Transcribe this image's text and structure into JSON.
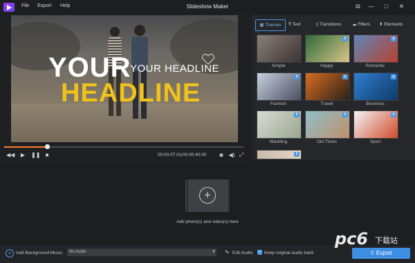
{
  "window": {
    "title": "Slideshow Maker",
    "menu": [
      "File",
      "Export",
      "Help"
    ],
    "controls": {
      "screenshot": "⧉",
      "minimize": "—",
      "maximize": "□",
      "close": "✕"
    }
  },
  "preview": {
    "headline_line1": "YOUR",
    "headline_small": "YOUR HEADLINE",
    "headline_line2": "HEADLINE",
    "headline_color": "#f0c21c"
  },
  "playback": {
    "progress_fraction": 0.18,
    "timecode": "00:00:07.01/00:00:40.00",
    "accent": "#ff7a2e"
  },
  "panel": {
    "tabs": [
      {
        "label": "Themes",
        "icon": "themes-icon",
        "selected": true
      },
      {
        "label": "Text",
        "icon": "text-icon"
      },
      {
        "label": "Transitions",
        "icon": "transitions-icon"
      },
      {
        "label": "Filters",
        "icon": "filters-icon"
      },
      {
        "label": "Elements",
        "icon": "elements-icon"
      }
    ],
    "themes": [
      {
        "label": "Simple",
        "colors": [
          "#8a7f78",
          "#3c3432"
        ],
        "download": false
      },
      {
        "label": "Happy",
        "colors": [
          "#2f6b3a",
          "#d8c489"
        ],
        "download": true
      },
      {
        "label": "Romantic",
        "colors": [
          "#5f86b8",
          "#b8412f"
        ],
        "download": true
      },
      {
        "label": "Fashion",
        "colors": [
          "#c7d1de",
          "#4b4f63"
        ],
        "download": true
      },
      {
        "label": "Travel",
        "colors": [
          "#d96d1f",
          "#2b2119"
        ],
        "download": true
      },
      {
        "label": "Business",
        "colors": [
          "#2f7fcf",
          "#0f3a68"
        ],
        "download": true
      },
      {
        "label": "Wedding",
        "colors": [
          "#d9dbd6",
          "#9aa68e"
        ],
        "download": true
      },
      {
        "label": "Old Times",
        "colors": [
          "#8fc0c9",
          "#c08f6a"
        ],
        "download": true
      },
      {
        "label": "Sport",
        "colors": [
          "#f2f4f7",
          "#d04b2a"
        ],
        "download": true
      }
    ]
  },
  "storyboard": {
    "add_text": "Add photo(s) and video(s) here",
    "add_symbol": "+"
  },
  "bottom": {
    "music_label": "Add Background Music:",
    "music_value": "No Audio",
    "edit_audio": "Edit Audio",
    "keep_audio": "Keep original audio track",
    "keep_checked": true,
    "export": "Export"
  },
  "accent": "#3d8fe4",
  "watermark": "pc6 下载站"
}
